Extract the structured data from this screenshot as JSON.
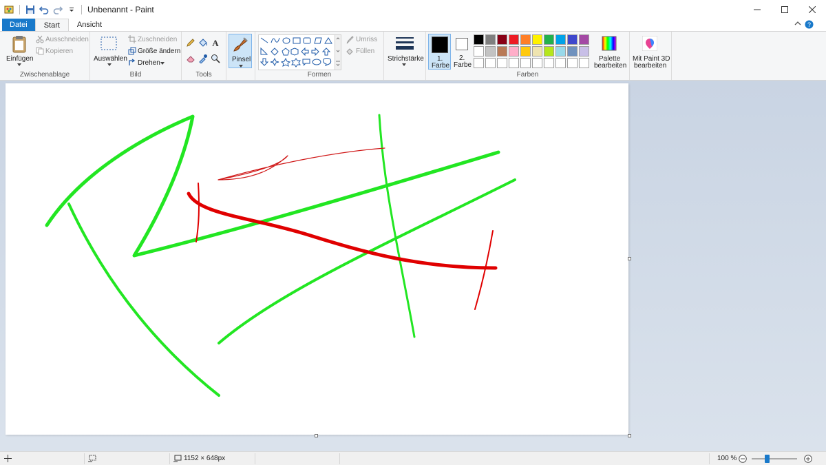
{
  "window": {
    "title": "Unbenannt - Paint"
  },
  "tabs": [
    {
      "label": "Datei"
    },
    {
      "label": "Start"
    },
    {
      "label": "Ansicht"
    }
  ],
  "clipboard": {
    "paste_label": "Einfügen",
    "cut_label": "Ausschneiden",
    "copy_label": "Kopieren",
    "group_label": "Zwischenablage"
  },
  "image": {
    "select_label": "Auswählen",
    "crop_label": "Zuschneiden",
    "resize_label": "Größe ändern",
    "rotate_label": "Drehen",
    "group_label": "Bild"
  },
  "tools": {
    "group_label": "Tools",
    "brush_label": "Pinsel"
  },
  "shapes": {
    "outline_label": "Umriss",
    "fill_label": "Füllen",
    "group_label": "Formen"
  },
  "size": {
    "label": "Strichstärke"
  },
  "colors": {
    "color1_line1": "1.",
    "color1_line2": "Farbe",
    "color2_line1": "2.",
    "color2_line2": "Farbe",
    "group_label": "Farben",
    "edit_palette_line1": "Palette",
    "edit_palette_line2": "bearbeiten",
    "paint3d_line1": "Mit Paint 3D",
    "paint3d_line2": "bearbeiten",
    "palette": [
      "#000000",
      "#7f7f7f",
      "#880015",
      "#ed1c24",
      "#ff7f27",
      "#fff200",
      "#22b14c",
      "#00a2e8",
      "#3f48cc",
      "#a349a4",
      "#ffffff",
      "#c3c3c3",
      "#b97a57",
      "#ffaec9",
      "#ffc90e",
      "#efe4b0",
      "#b5e61d",
      "#99d9ea",
      "#7092be",
      "#c8bfe7",
      "#ffffff",
      "#ffffff",
      "#ffffff",
      "#ffffff",
      "#ffffff",
      "#ffffff",
      "#ffffff",
      "#ffffff",
      "#ffffff",
      "#ffffff"
    ],
    "primary": "#000000",
    "secondary": "#ffffff"
  },
  "status": {
    "dimensions": "1152 × 648px",
    "zoom": "100 %",
    "zoom_fraction": 0.33
  },
  "accent": "#1979ca"
}
